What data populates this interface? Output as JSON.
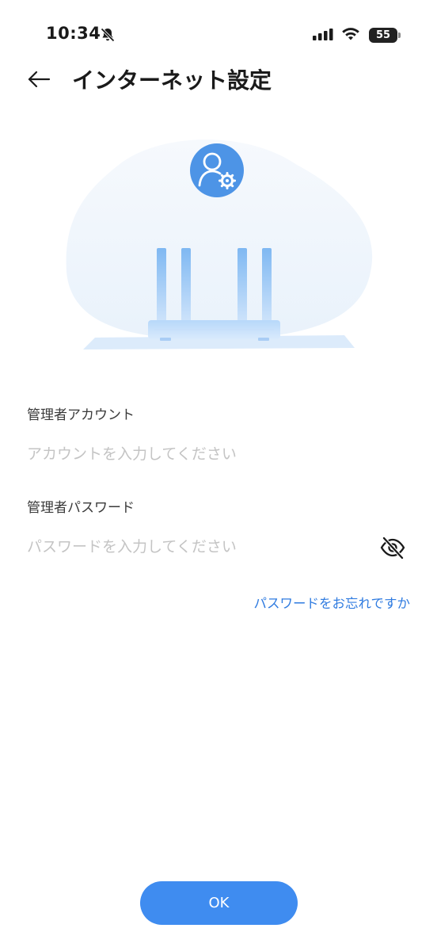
{
  "status_bar": {
    "time": "10:34",
    "battery": "55",
    "icons": [
      "bell-off-icon",
      "signal-icon",
      "wifi-icon",
      "battery-icon"
    ]
  },
  "header": {
    "title": "インターネット設定",
    "back_icon": "arrow-left-icon"
  },
  "illustration": {
    "badge_icon": "user-settings-icon",
    "subject": "router"
  },
  "form": {
    "account": {
      "label": "管理者アカウント",
      "value": "",
      "placeholder": "アカウントを入力してください"
    },
    "password": {
      "label": "管理者パスワード",
      "value": "",
      "placeholder": "パスワードを入力してください",
      "toggle_icon": "eye-off-icon"
    },
    "forgot_link": "パスワードをお忘れですか"
  },
  "footer": {
    "ok_label": "OK"
  },
  "colors": {
    "accent": "#3f8cf0",
    "link": "#2f7be0",
    "placeholder": "#c4c4c4",
    "illustration_bg": "#eef5fc",
    "router_blue": "#a9d0f8"
  }
}
